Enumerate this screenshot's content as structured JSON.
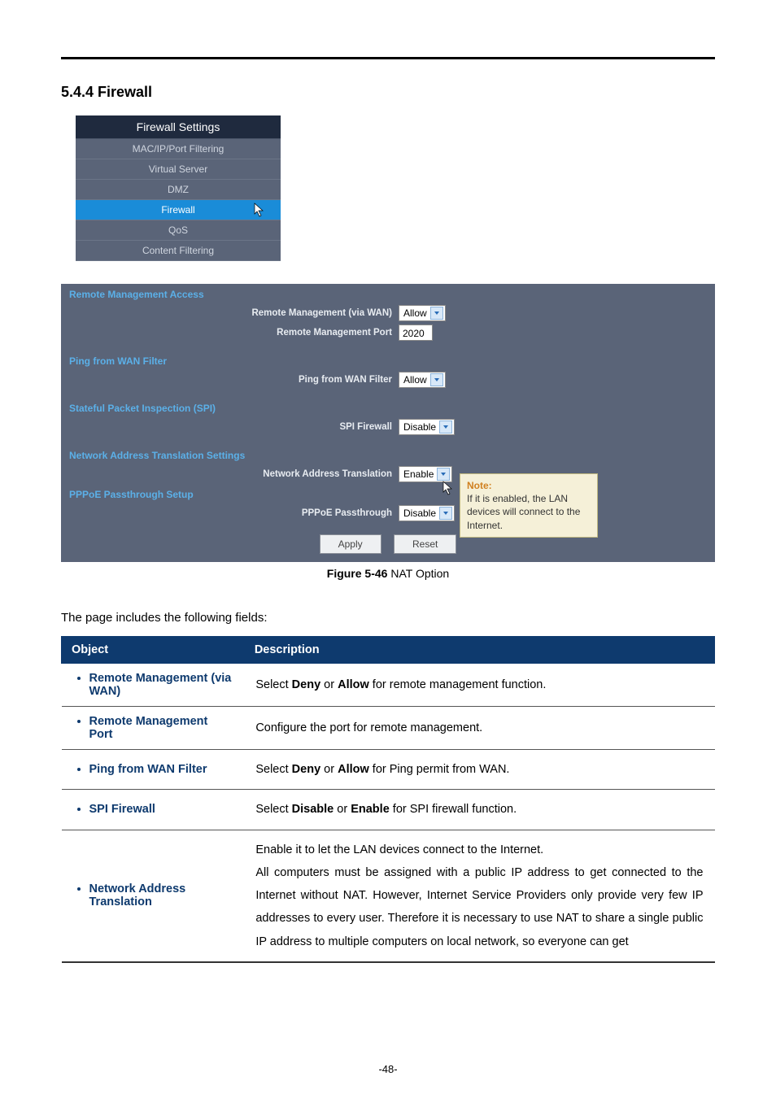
{
  "heading": "5.4.4  Firewall",
  "nav": {
    "title": "Firewall Settings",
    "items": [
      "MAC/IP/Port Filtering",
      "Virtual Server",
      "DMZ",
      "Firewall",
      "QoS",
      "Content Filtering"
    ],
    "active_index": 3
  },
  "config": {
    "sections": {
      "remote_mgmt": "Remote Management Access",
      "ping_wan": "Ping from WAN Filter",
      "spi": "Stateful Packet Inspection (SPI)",
      "nat": "Network Address Translation Settings",
      "pppoe": "PPPoE Passthrough Setup"
    },
    "fields": {
      "remote_mgmt_wan": {
        "label": "Remote Management (via WAN)",
        "value": "Allow"
      },
      "remote_mgmt_port": {
        "label": "Remote Management Port",
        "value": "2020"
      },
      "ping_filter": {
        "label": "Ping from WAN Filter",
        "value": "Allow"
      },
      "spi_firewall": {
        "label": "SPI Firewall",
        "value": "Disable"
      },
      "nat": {
        "label": "Network Address Translation",
        "value": "Enable"
      },
      "pppoe": {
        "label": "PPPoE Passthrough",
        "value": "Disable"
      }
    },
    "buttons": {
      "apply": "Apply",
      "reset": "Reset"
    },
    "tooltip": {
      "title": "Note:",
      "body": "If it is enabled, the LAN devices will connect to the Internet."
    }
  },
  "caption": {
    "bold": "Figure 5-46",
    "rest": " NAT Option"
  },
  "intro": "The page includes the following fields:",
  "table": {
    "head": {
      "object": "Object",
      "description": "Description"
    },
    "rows": [
      {
        "object": "Remote Management (via WAN)",
        "desc_pre": "Select ",
        "desc_b1": "Deny",
        "desc_mid": " or ",
        "desc_b2": "Allow",
        "desc_post": " for remote management function."
      },
      {
        "object": "Remote Management Port",
        "desc_plain": "Configure the port for remote management."
      },
      {
        "object": "Ping from WAN Filter",
        "desc_pre": "Select ",
        "desc_b1": "Deny",
        "desc_mid": " or ",
        "desc_b2": "Allow",
        "desc_post": " for Ping permit from WAN."
      },
      {
        "object": "SPI Firewall",
        "desc_pre": "Select ",
        "desc_b1": "Disable",
        "desc_mid": " or ",
        "desc_b2": "Enable",
        "desc_post": " for SPI firewall function."
      },
      {
        "object": "Network Address Translation",
        "desc_long": "Enable it to let the LAN devices connect to the Internet.\nAll computers must be assigned with a public IP address to get connected to the Internet without NAT. However, Internet Service Providers only provide very few IP addresses to every user. Therefore it is necessary to use NAT to share a single public IP address to multiple computers on local network, so everyone can get"
      }
    ]
  },
  "pagenum": "-48-"
}
